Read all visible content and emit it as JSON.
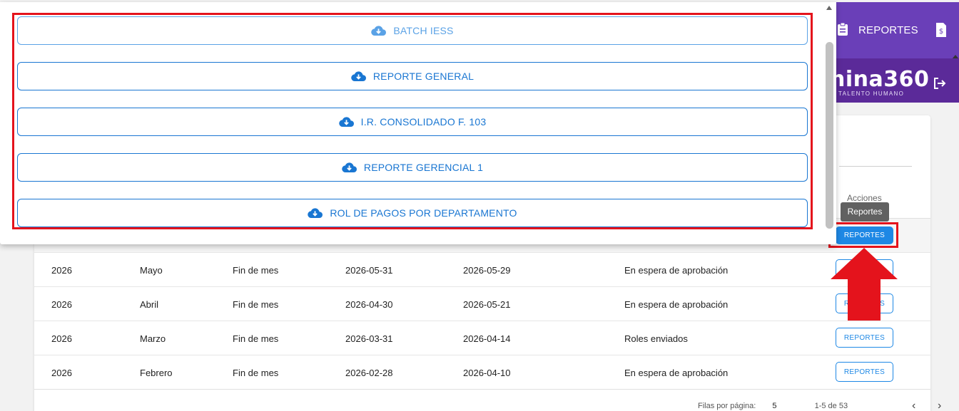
{
  "topbar": {
    "reportes_label": "REPORTES",
    "icons": [
      "clipboard-icon",
      "invoice-icon"
    ]
  },
  "brand": {
    "logo": "nina360",
    "tagline": "E TALENTO HUMANO",
    "icons": [
      "logout-icon"
    ]
  },
  "table": {
    "acciones_header": "Acciones",
    "rows": [
      {
        "year": "2026",
        "month": "Mayo",
        "type": "Fin de mes",
        "date1": "2026-05-31",
        "date2": "2026-05-29",
        "status": "En espera de aprobación",
        "action": "REPORTES"
      },
      {
        "year": "2026",
        "month": "Abril",
        "type": "Fin de mes",
        "date1": "2026-04-30",
        "date2": "2026-05-21",
        "status": "En espera de aprobación",
        "action": "REPORTES"
      },
      {
        "year": "2026",
        "month": "Marzo",
        "type": "Fin de mes",
        "date1": "2026-03-31",
        "date2": "2026-04-14",
        "status": "Roles enviados",
        "action": "REPORTES"
      },
      {
        "year": "2026",
        "month": "Febrero",
        "type": "Fin de mes",
        "date1": "2026-02-28",
        "date2": "2026-04-10",
        "status": "En espera de aprobación",
        "action": "REPORTES"
      }
    ],
    "active_button": "REPORTES",
    "tooltip": "Reportes",
    "pager": {
      "rows_label": "Filas por página:",
      "rows_value": "5",
      "range": "1-5 de 53",
      "prev": "‹",
      "next": "›"
    }
  },
  "dialog": {
    "buttons": [
      {
        "label": "BATCH IESS",
        "icon": "cloud-download-icon"
      },
      {
        "label": "REPORTE GENERAL",
        "icon": "cloud-download-icon"
      },
      {
        "label": "I.R. CONSOLIDADO F. 103",
        "icon": "cloud-download-icon"
      },
      {
        "label": "REPORTE GERENCIAL 1",
        "icon": "cloud-download-icon"
      },
      {
        "label": "ROL DE PAGOS POR DEPARTAMENTO",
        "icon": "cloud-download-icon"
      }
    ]
  },
  "colors": {
    "accent": "#1976d2",
    "highlight": "#e4131c",
    "purple": "#6a3fb8"
  }
}
